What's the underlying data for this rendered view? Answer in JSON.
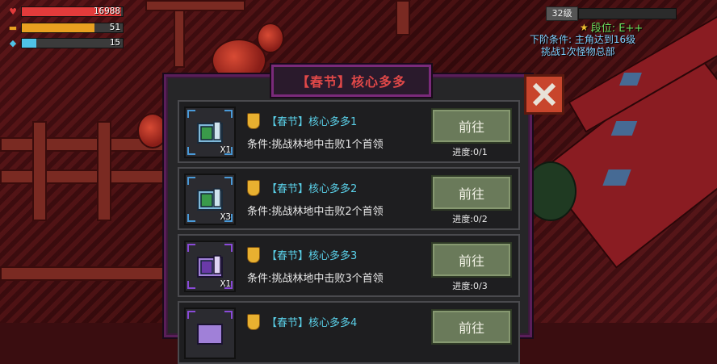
{
  "hud": {
    "hp": {
      "value": "16988",
      "fill": 0.98,
      "color": "#e23b3b"
    },
    "armor": {
      "value": "51",
      "fill": 0.72,
      "color": "#e8a020"
    },
    "energy": {
      "value": "15",
      "fill": 0.14,
      "color": "#4fc3e8"
    }
  },
  "level": {
    "label": "32级"
  },
  "rank": {
    "label": "段位: E++"
  },
  "quest_hint": {
    "line1": "下阶条件: 主角达到16级",
    "line2": "挑战1次怪物总部"
  },
  "dialog": {
    "title": "【春节】核心多多",
    "tasks": [
      {
        "title": "【春节】核心多多1",
        "condition": "条件:挑战林地中击败1个首领",
        "button": "前往",
        "progress": "进度:0/1",
        "qty": "X1",
        "icon_color": "#4aa0c8",
        "frame_color": "#3a88c8"
      },
      {
        "title": "【春节】核心多多2",
        "condition": "条件:挑战林地中击败2个首领",
        "button": "前往",
        "progress": "进度:0/2",
        "qty": "X3",
        "icon_color": "#4aa0c8",
        "frame_color": "#3a88c8"
      },
      {
        "title": "【春节】核心多多3",
        "condition": "条件:挑战林地中击败3个首领",
        "button": "前往",
        "progress": "进度:0/3",
        "qty": "X1",
        "icon_color": "#8a5ad0",
        "frame_color": "#8a4ad8"
      },
      {
        "title": "【春节】核心多多4",
        "condition": "",
        "button": "前往",
        "progress": "",
        "qty": "",
        "icon_color": "#8a5ad0",
        "frame_color": "#8a4ad8"
      }
    ]
  },
  "icons": {
    "hp": "heart-icon",
    "armor": "shield-icon",
    "energy": "energy-drop-icon",
    "rank": "star-icon",
    "close": "close-icon",
    "task": "shield-badge-icon",
    "reward": "core-chest-icon"
  }
}
